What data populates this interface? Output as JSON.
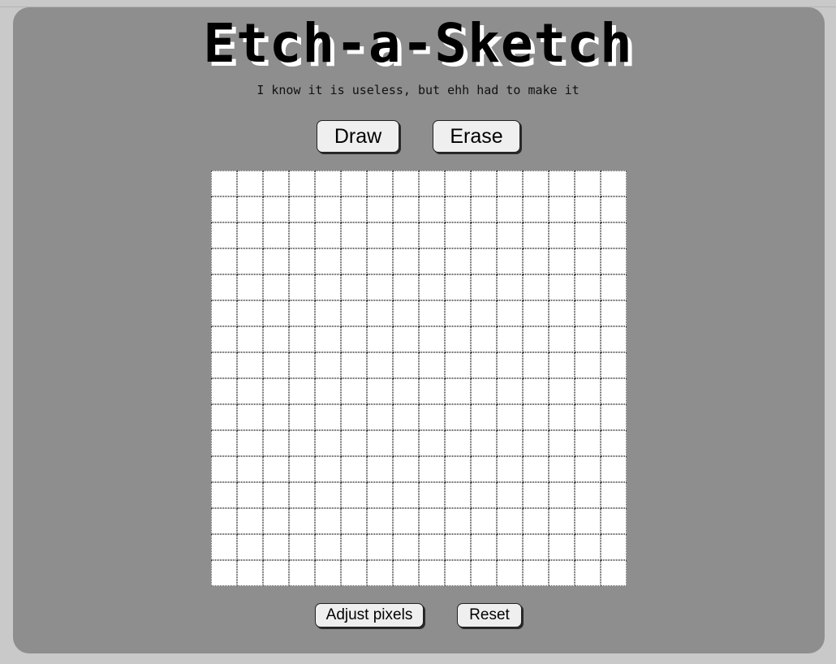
{
  "header": {
    "title": "Etch-a-Sketch",
    "subtitle": "I know it is useless, but ehh had to make it"
  },
  "mode_buttons": {
    "draw_label": "Draw",
    "erase_label": "Erase"
  },
  "controls": {
    "adjust_label": "Adjust pixels",
    "reset_label": "Reset"
  },
  "canvas": {
    "rows": 16,
    "columns": 16,
    "cell_color": "#ffffff",
    "grid_line_color": "#555555"
  },
  "colors": {
    "page_background": "#c9c9c9",
    "panel_background": "#8e8e8e",
    "button_background": "#efefef",
    "title_shadow": "#ffffff"
  }
}
